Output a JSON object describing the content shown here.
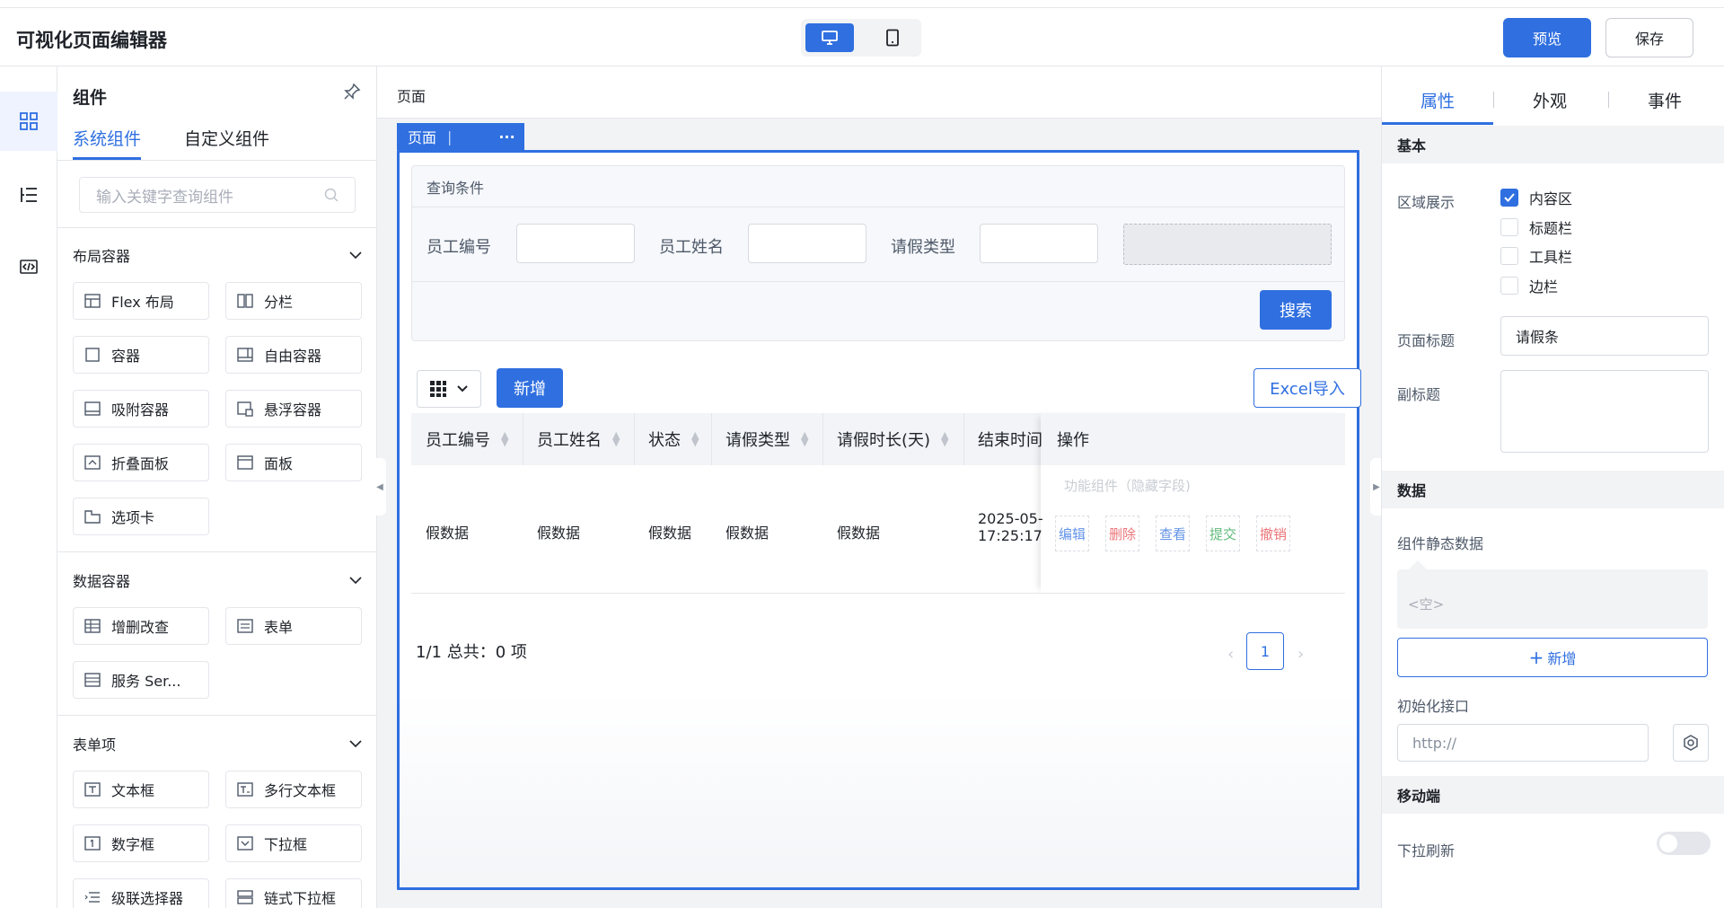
{
  "app": {
    "title": "可视化页面编辑器"
  },
  "header": {
    "preview_label": "预览",
    "save_label": "保存",
    "device": "desktop"
  },
  "components_panel": {
    "title": "组件",
    "tabs": [
      {
        "label": "系统组件",
        "active": true
      },
      {
        "label": "自定义组件",
        "active": false
      }
    ],
    "search_placeholder": "输入关键字查询组件",
    "sections": [
      {
        "title": "布局容器",
        "items": [
          "Flex 布局",
          "分栏",
          "容器",
          "自由容器",
          "吸附容器",
          "悬浮容器",
          "折叠面板",
          "面板",
          "选项卡"
        ]
      },
      {
        "title": "数据容器",
        "items": [
          "增删改查",
          "表单",
          "服务 Ser..."
        ]
      },
      {
        "title": "表单项",
        "items": [
          "文本框",
          "多行文本框",
          "数字框",
          "下拉框",
          "级联选择器",
          "链式下拉框"
        ]
      }
    ]
  },
  "canvas": {
    "header_title": "页面",
    "page_tag": "页面",
    "query": {
      "title": "查询条件",
      "fields": [
        "员工编号",
        "员工姓名",
        "请假类型"
      ],
      "search_label": "搜索"
    },
    "toolbar": {
      "add_label": "新增",
      "excel_label": "Excel导入"
    },
    "table": {
      "columns": [
        "员工编号",
        "员工姓名",
        "状态",
        "请假类型",
        "请假时长(天)",
        "结束时间",
        "操作"
      ],
      "row": [
        "假数据",
        "假数据",
        "假数据",
        "假数据",
        "假数据"
      ],
      "end_time_line1": "2025-05-",
      "end_time_line2": "17:25:17",
      "func_label": "功能组件（隐藏字段)",
      "ops": [
        {
          "label": "编辑",
          "color": "#2f6fe0"
        },
        {
          "label": "删除",
          "color": "#e5484d"
        },
        {
          "label": "查看",
          "color": "#2f6fe0"
        },
        {
          "label": "提交",
          "color": "#2ea44f"
        },
        {
          "label": "撤销",
          "color": "#e5484d"
        }
      ]
    },
    "pager": {
      "summary": "1/1 总共：0 项",
      "current": "1"
    }
  },
  "props_panel": {
    "tabs": [
      {
        "label": "属性",
        "active": true
      },
      {
        "label": "外观",
        "active": false
      },
      {
        "label": "事件",
        "active": false
      }
    ],
    "basic": {
      "section": "基本",
      "area_label": "区域展示",
      "area_options": [
        {
          "label": "内容区",
          "checked": true
        },
        {
          "label": "标题栏",
          "checked": false
        },
        {
          "label": "工具栏",
          "checked": false
        },
        {
          "label": "边栏",
          "checked": false
        }
      ],
      "page_title_label": "页面标题",
      "page_title_value": "请假条",
      "subtitle_label": "副标题"
    },
    "data": {
      "section": "数据",
      "static_label": "组件静态数据",
      "static_value": "<空>",
      "add_label": "新增",
      "api_label": "初始化接口",
      "api_placeholder": "http://"
    },
    "mobile": {
      "section": "移动端",
      "pull_refresh_label": "下拉刷新",
      "pull_refresh_on": false
    }
  }
}
